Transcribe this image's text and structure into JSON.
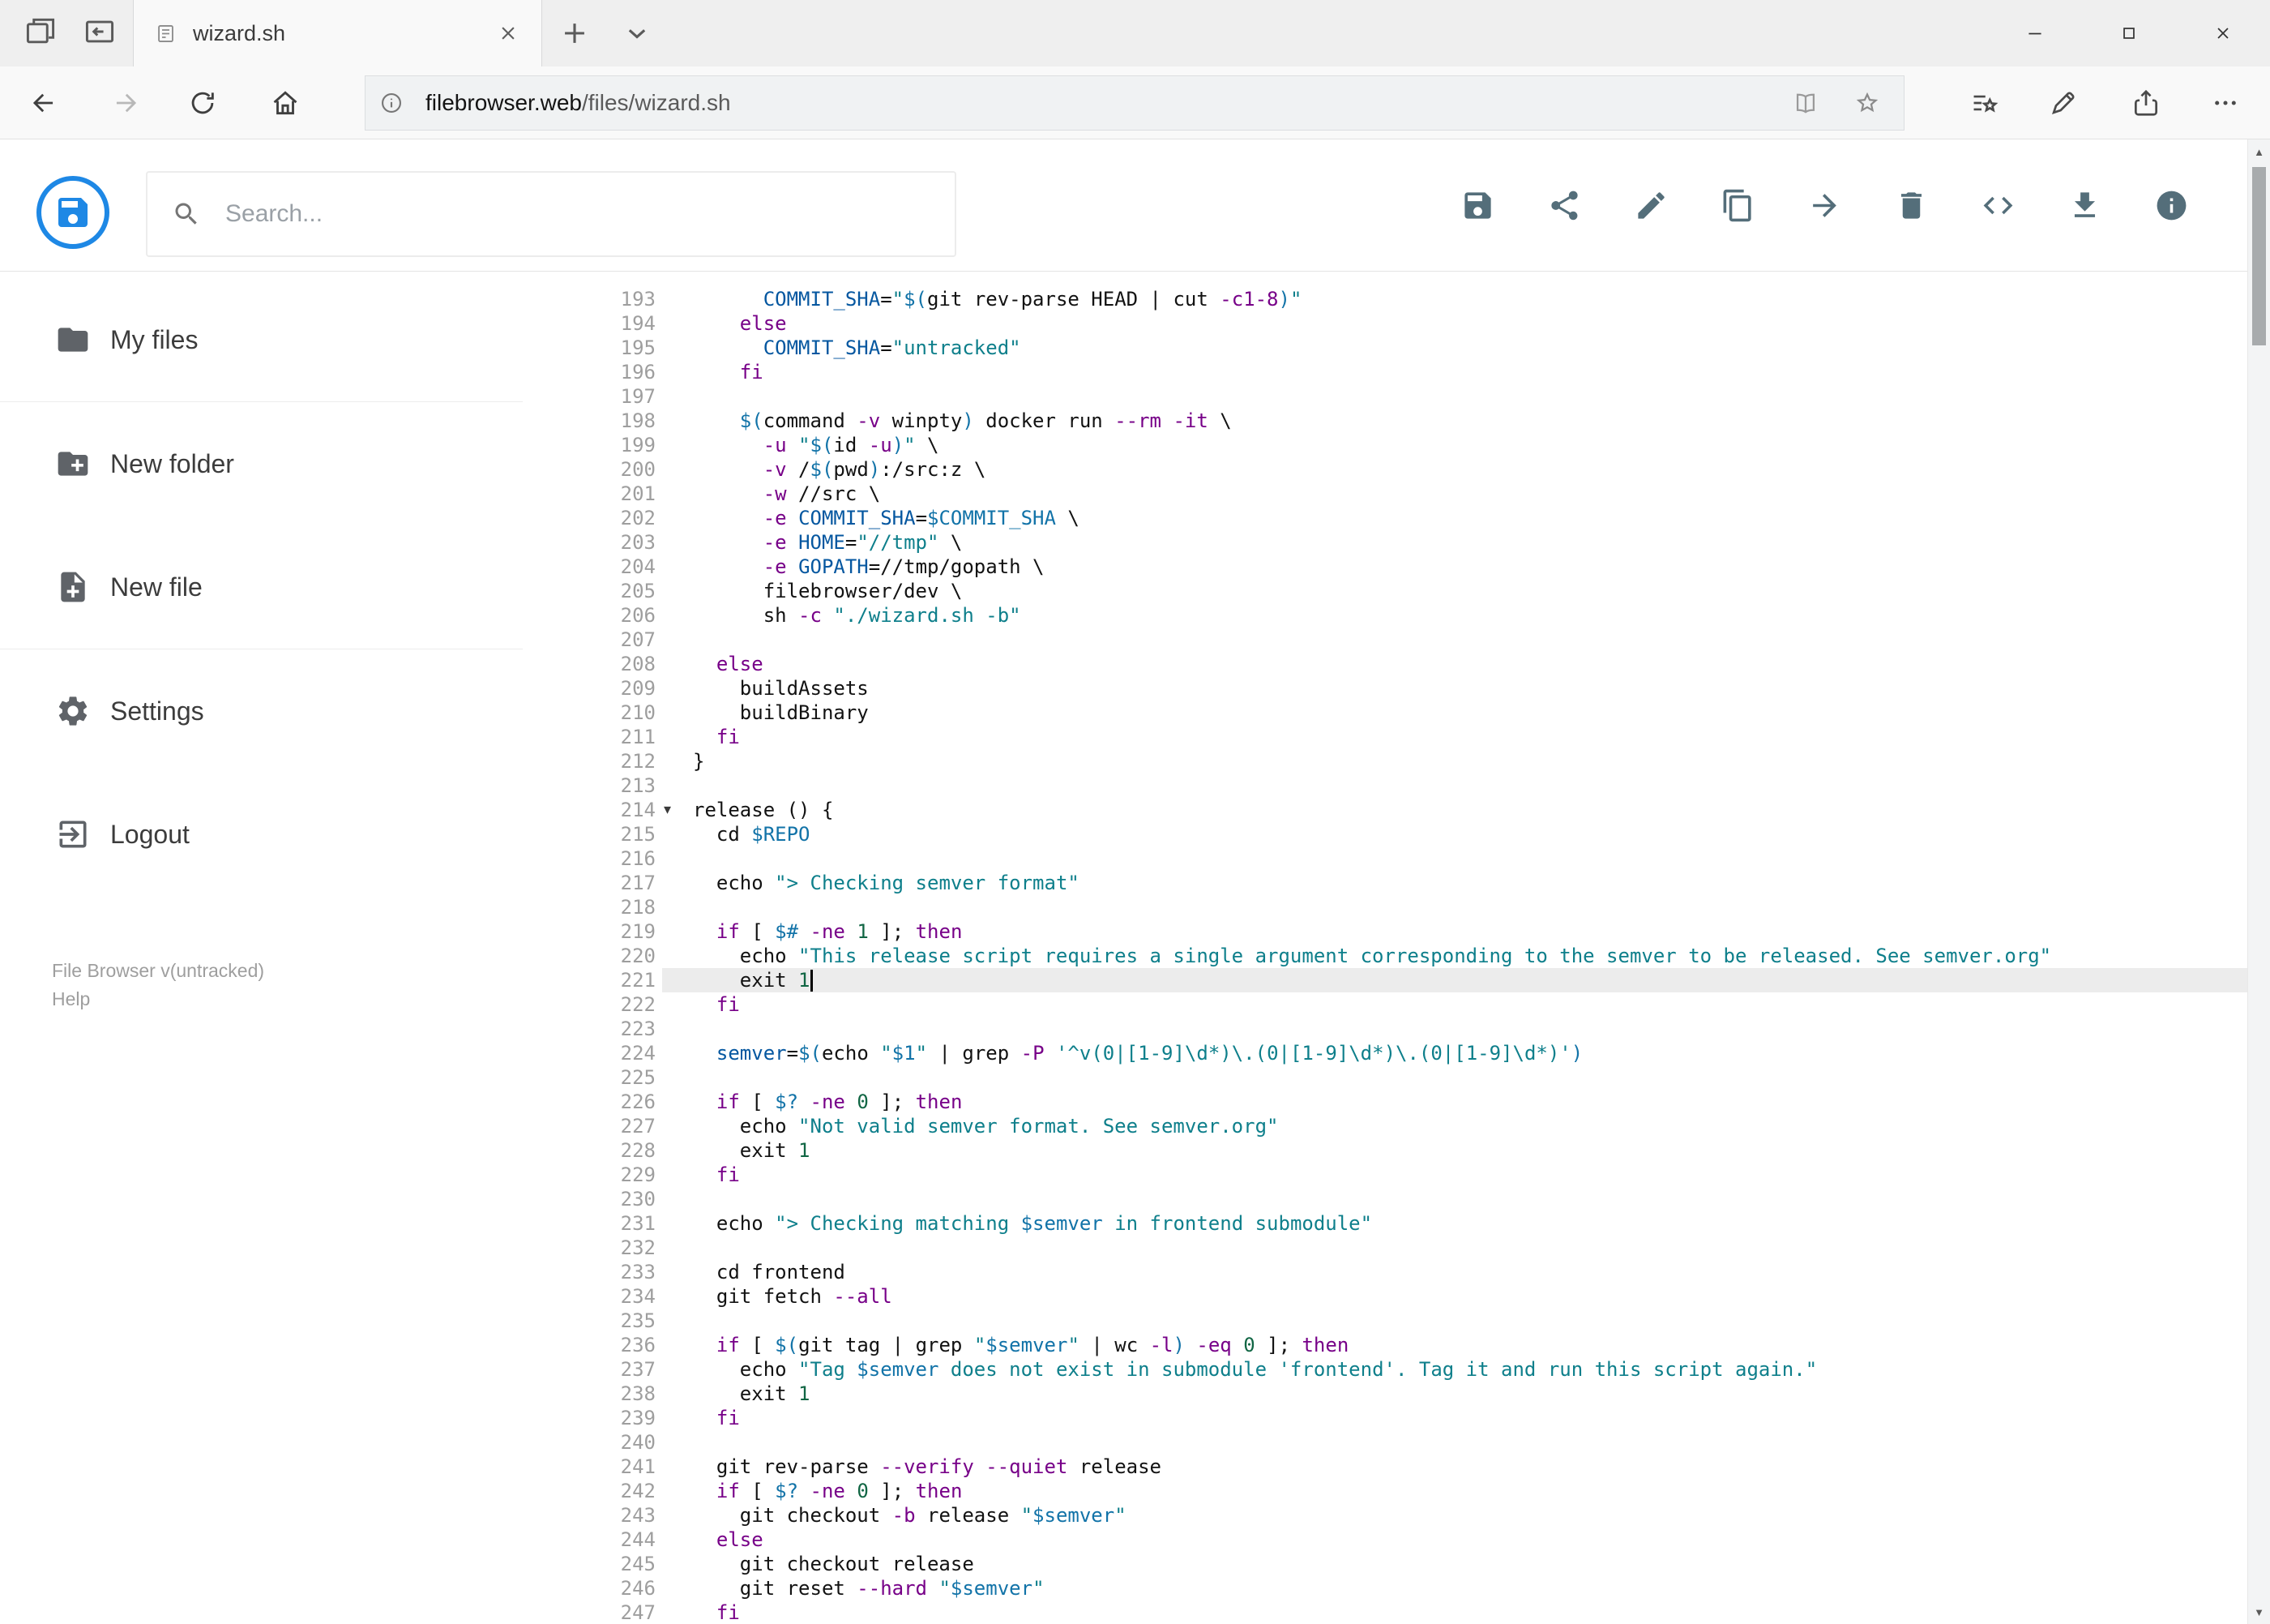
{
  "browser": {
    "tab_title": "wizard.sh",
    "url_host": "filebrowser.web",
    "url_path": "/files/wizard.sh"
  },
  "header": {
    "search_placeholder": "Search..."
  },
  "toolbar": {
    "buttons": [
      {
        "name": "save"
      },
      {
        "name": "share"
      },
      {
        "name": "rename"
      },
      {
        "name": "copy"
      },
      {
        "name": "move"
      },
      {
        "name": "delete"
      },
      {
        "name": "code"
      },
      {
        "name": "download"
      },
      {
        "name": "info"
      }
    ]
  },
  "sidebar": {
    "items": [
      {
        "icon": "folder",
        "label": "My files"
      },
      {
        "icon": "new-folder",
        "label": "New folder"
      },
      {
        "icon": "new-file",
        "label": "New file"
      },
      {
        "icon": "settings",
        "label": "Settings"
      },
      {
        "icon": "logout",
        "label": "Logout"
      }
    ],
    "dividers_after": [
      0,
      2
    ],
    "footer": {
      "version": "File Browser v(untracked)",
      "help": "Help"
    }
  },
  "editor": {
    "language": "shell",
    "active_line": 221,
    "fold_lines": [
      214
    ],
    "lines": [
      {
        "n": 193,
        "text": "      COMMIT_SHA=\"$(git rev-parse HEAD | cut -c1-8)\""
      },
      {
        "n": 194,
        "text": "    else"
      },
      {
        "n": 195,
        "text": "      COMMIT_SHA=\"untracked\""
      },
      {
        "n": 196,
        "text": "    fi"
      },
      {
        "n": 197,
        "text": ""
      },
      {
        "n": 198,
        "text": "    $(command -v winpty) docker run --rm -it \\"
      },
      {
        "n": 199,
        "text": "      -u \"$(id -u)\" \\"
      },
      {
        "n": 200,
        "text": "      -v /$(pwd):/src:z \\"
      },
      {
        "n": 201,
        "text": "      -w //src \\"
      },
      {
        "n": 202,
        "text": "      -e COMMIT_SHA=$COMMIT_SHA \\"
      },
      {
        "n": 203,
        "text": "      -e HOME=\"//tmp\" \\"
      },
      {
        "n": 204,
        "text": "      -e GOPATH=//tmp/gopath \\"
      },
      {
        "n": 205,
        "text": "      filebrowser/dev \\"
      },
      {
        "n": 206,
        "text": "      sh -c \"./wizard.sh -b\""
      },
      {
        "n": 207,
        "text": ""
      },
      {
        "n": 208,
        "text": "  else"
      },
      {
        "n": 209,
        "text": "    buildAssets"
      },
      {
        "n": 210,
        "text": "    buildBinary"
      },
      {
        "n": 211,
        "text": "  fi"
      },
      {
        "n": 212,
        "text": "}"
      },
      {
        "n": 213,
        "text": ""
      },
      {
        "n": 214,
        "text": "release () {"
      },
      {
        "n": 215,
        "text": "  cd $REPO"
      },
      {
        "n": 216,
        "text": ""
      },
      {
        "n": 217,
        "text": "  echo \"> Checking semver format\""
      },
      {
        "n": 218,
        "text": ""
      },
      {
        "n": 219,
        "text": "  if [ $# -ne 1 ]; then"
      },
      {
        "n": 220,
        "text": "    echo \"This release script requires a single argument corresponding to the semver to be released. See semver.org\""
      },
      {
        "n": 221,
        "text": "    exit 1"
      },
      {
        "n": 222,
        "text": "  fi"
      },
      {
        "n": 223,
        "text": ""
      },
      {
        "n": 224,
        "text": "  semver=$(echo \"$1\" | grep -P '^v(0|[1-9]\\d*)\\.(0|[1-9]\\d*)\\.(0|[1-9]\\d*)')"
      },
      {
        "n": 225,
        "text": ""
      },
      {
        "n": 226,
        "text": "  if [ $? -ne 0 ]; then"
      },
      {
        "n": 227,
        "text": "    echo \"Not valid semver format. See semver.org\""
      },
      {
        "n": 228,
        "text": "    exit 1"
      },
      {
        "n": 229,
        "text": "  fi"
      },
      {
        "n": 230,
        "text": ""
      },
      {
        "n": 231,
        "text": "  echo \"> Checking matching $semver in frontend submodule\""
      },
      {
        "n": 232,
        "text": ""
      },
      {
        "n": 233,
        "text": "  cd frontend"
      },
      {
        "n": 234,
        "text": "  git fetch --all"
      },
      {
        "n": 235,
        "text": ""
      },
      {
        "n": 236,
        "text": "  if [ $(git tag | grep \"$semver\" | wc -l) -eq 0 ]; then"
      },
      {
        "n": 237,
        "text": "    echo \"Tag $semver does not exist in submodule 'frontend'. Tag it and run this script again.\""
      },
      {
        "n": 238,
        "text": "    exit 1"
      },
      {
        "n": 239,
        "text": "  fi"
      },
      {
        "n": 240,
        "text": ""
      },
      {
        "n": 241,
        "text": "  git rev-parse --verify --quiet release"
      },
      {
        "n": 242,
        "text": "  if [ $? -ne 0 ]; then"
      },
      {
        "n": 243,
        "text": "    git checkout -b release \"$semver\""
      },
      {
        "n": 244,
        "text": "  else"
      },
      {
        "n": 245,
        "text": "    git checkout release"
      },
      {
        "n": 246,
        "text": "    git reset --hard \"$semver\""
      },
      {
        "n": 247,
        "text": "  fi"
      }
    ]
  },
  "colors": {
    "accent": "#1e88e5",
    "toolbar_icon": "#546e7a",
    "syntax": {
      "keyword": "#770088",
      "flag": "#770088",
      "string": "#0e7f8b",
      "variable": "#1273a8",
      "definition": "#0557a0",
      "number": "#116644"
    }
  }
}
